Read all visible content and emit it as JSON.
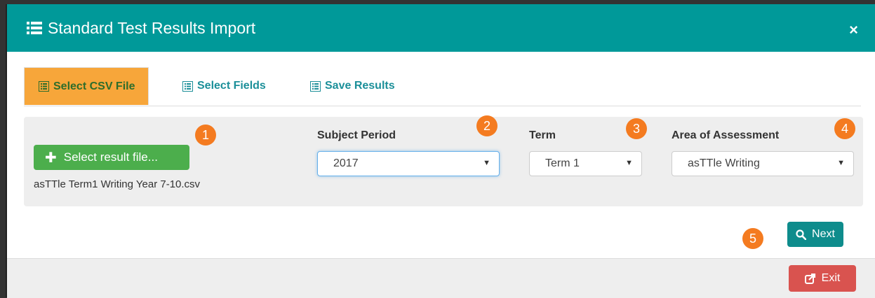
{
  "header": {
    "title": "Standard Test Results Import",
    "close_glyph": "×"
  },
  "tabs": [
    {
      "label": "Select CSV File",
      "active": true
    },
    {
      "label": "Select Fields",
      "active": false
    },
    {
      "label": "Save Results",
      "active": false
    }
  ],
  "file": {
    "button_label": "Select result file...",
    "filename": "asTTle Term1 Writing Year 7-10.csv"
  },
  "fields": {
    "subject_period": {
      "label": "Subject Period",
      "value": "2017"
    },
    "term": {
      "label": "Term",
      "value": "Term 1"
    },
    "area": {
      "label": "Area of Assessment",
      "value": "asTTle Writing"
    }
  },
  "badges": [
    "1",
    "2",
    "3",
    "4",
    "5"
  ],
  "buttons": {
    "next": "Next",
    "exit": "Exit"
  },
  "colors": {
    "header": "#009999",
    "active_tab": "#f7a63a",
    "badge": "#f47b20",
    "exit": "#d9534f"
  }
}
